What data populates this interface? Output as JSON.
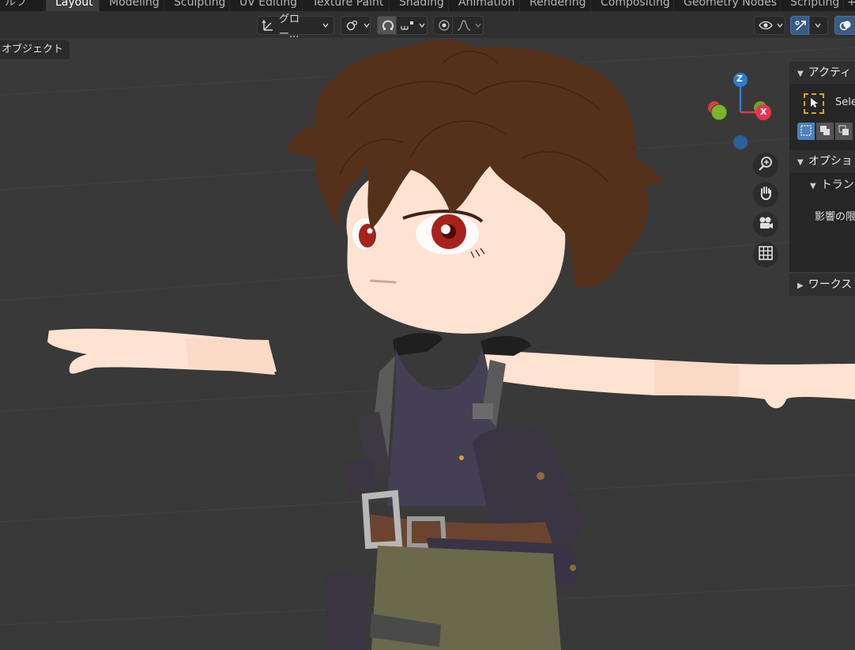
{
  "topbar": {
    "left_fragment": "ルフ",
    "tabs": [
      {
        "label": "Layout",
        "active": true
      },
      {
        "label": "Modeling"
      },
      {
        "label": "Sculpting"
      },
      {
        "label": "UV Editing"
      },
      {
        "label": "Texture Paint"
      },
      {
        "label": "Shading"
      },
      {
        "label": "Animation"
      },
      {
        "label": "Rendering"
      },
      {
        "label": "Compositing"
      },
      {
        "label": "Geometry Nodes"
      },
      {
        "label": "Scripting"
      }
    ],
    "add_tab": "+"
  },
  "header": {
    "orientation_label": "グロー...",
    "icons": [
      "transform-orientation-icon",
      "pivot-point-icon",
      "snap-icon",
      "snap-target-icon",
      "proportional-edit-icon",
      "falloff-curve-icon",
      "visibility-icon",
      "gizmo-toggle-icon",
      "overlay-icon"
    ]
  },
  "viewport": {
    "mode_label": "オブジェクト",
    "gizmo": {
      "z": "Z",
      "x": "X"
    },
    "nav_icons": [
      "zoom-icon",
      "hand-pan-icon",
      "camera-icon",
      "grid-icon"
    ]
  },
  "sidebar": {
    "active_tool_header": "アクティ",
    "tool_label": "Sele",
    "options_header": "オプショ",
    "transform_header": "トラン",
    "affect_label": "影響の限",
    "workspace_header": "ワークス"
  },
  "colors": {
    "axis_x": "#e5354f",
    "axis_y": "#6ea22a",
    "axis_z": "#2f7bd0",
    "accent_blue": "#4c7fbd",
    "viewport_bg": "#393939"
  }
}
